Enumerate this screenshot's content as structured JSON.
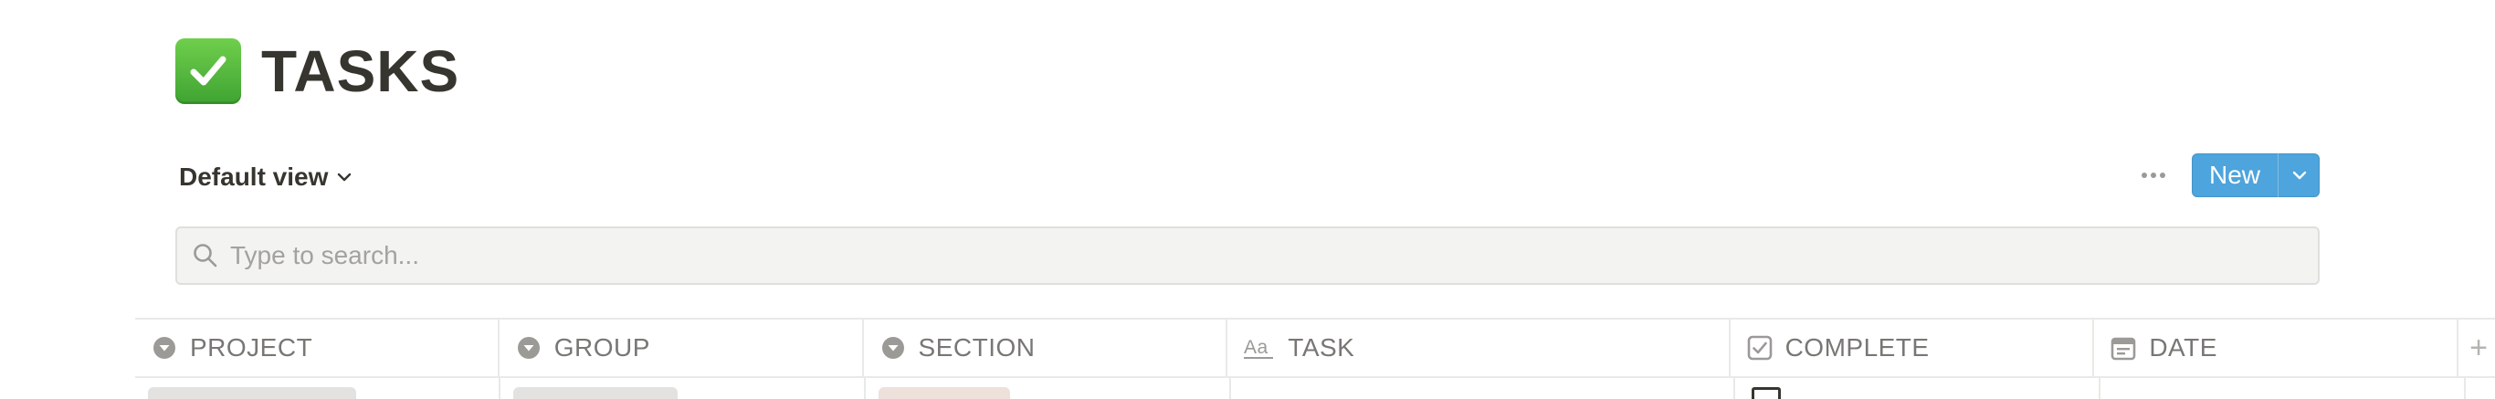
{
  "page": {
    "title": "TASKS",
    "title_icon": "green-checkmark-emoji"
  },
  "toolbar": {
    "view_label": "Default view",
    "more_icon": "ellipsis-icon",
    "new_label": "New",
    "accent_color": "#4ea4dc"
  },
  "search": {
    "placeholder": "Type to search...",
    "value": ""
  },
  "table": {
    "columns": [
      {
        "label": "PROJECT",
        "icon": "select-icon"
      },
      {
        "label": "GROUP",
        "icon": "select-icon"
      },
      {
        "label": "SECTION",
        "icon": "select-icon"
      },
      {
        "label": "TASK",
        "icon": "text-icon"
      },
      {
        "label": "COMPLETE",
        "icon": "checkbox-icon"
      },
      {
        "label": "DATE",
        "icon": "calendar-icon"
      }
    ],
    "add_column_label": "+",
    "first_row": {
      "project_tag_color": "#e3e2e0",
      "group_tag_color": "#e3e2e0",
      "section_tag_color": "#eee0da"
    }
  }
}
